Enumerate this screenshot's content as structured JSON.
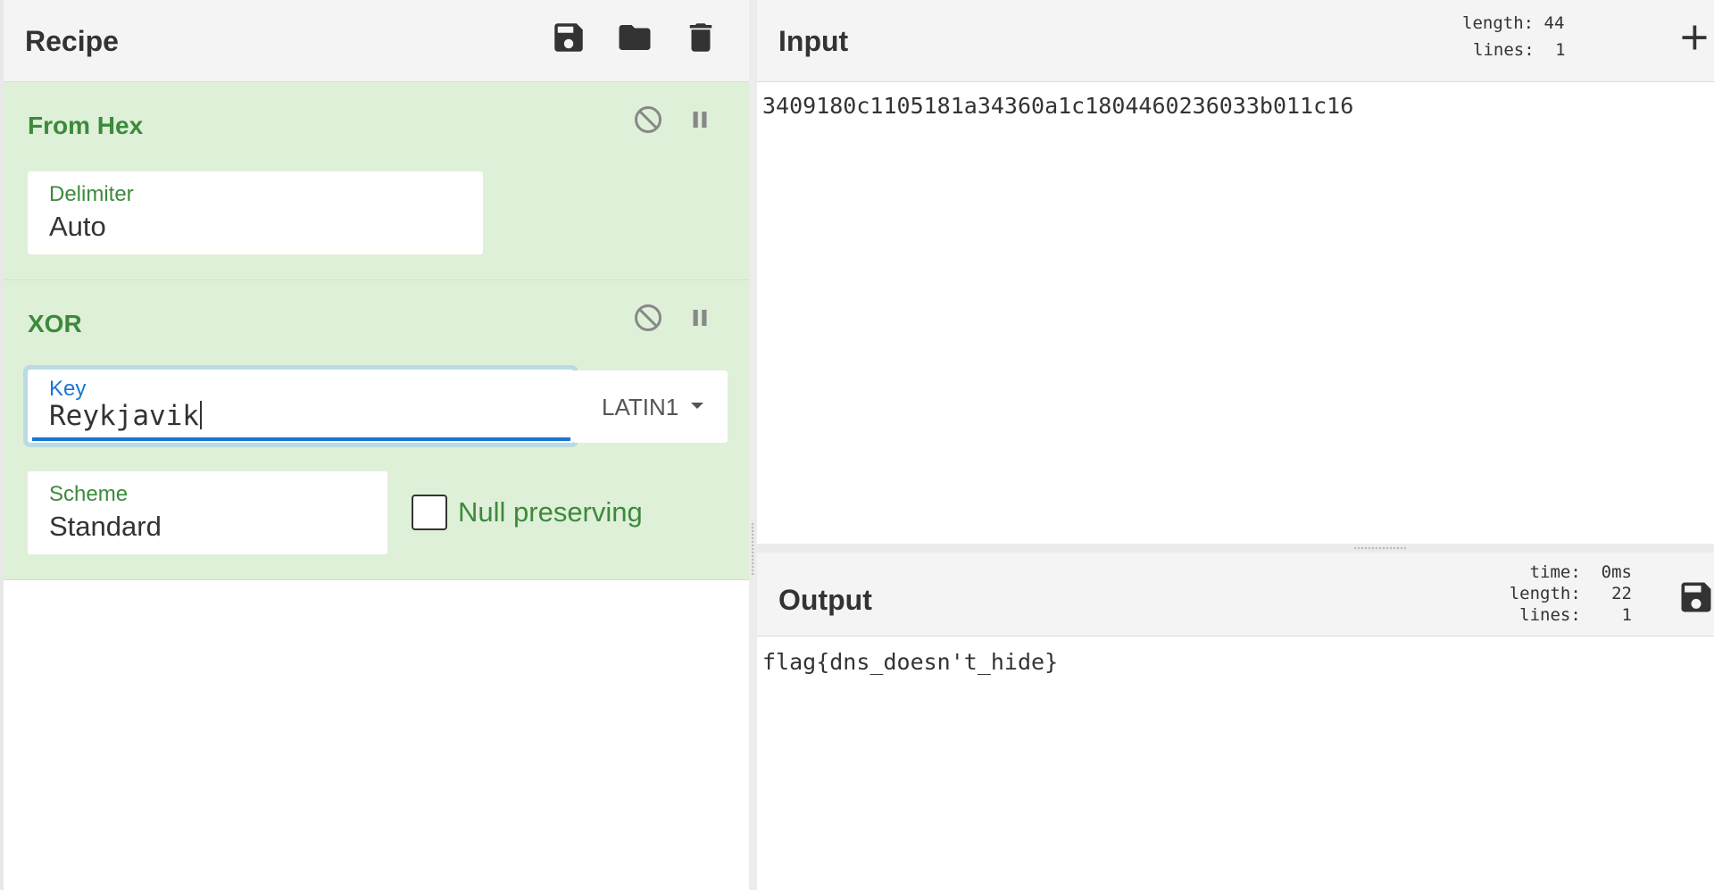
{
  "recipe": {
    "title": "Recipe",
    "icons": [
      "save-icon",
      "folder-icon",
      "trash-icon"
    ],
    "operations": [
      {
        "name": "From Hex",
        "fields": [
          {
            "label": "Delimiter",
            "value": "Auto"
          }
        ]
      },
      {
        "name": "XOR",
        "key": {
          "label": "Key",
          "value": "Reykjavik",
          "encoding": "LATIN1"
        },
        "scheme": {
          "label": "Scheme",
          "value": "Standard"
        },
        "null_preserving": {
          "label": "Null preserving",
          "checked": false
        }
      }
    ]
  },
  "input": {
    "title": "Input",
    "stats": {
      "length_label": "length:",
      "length": "44",
      "lines_label": "lines:",
      "lines": "1"
    },
    "text": "3409180c1105181a34360a1c1804460236033b011c16"
  },
  "output": {
    "title": "Output",
    "stats": {
      "time_label": "time:",
      "time": "0ms",
      "length_label": "length:",
      "length": "22",
      "lines_label": "lines:",
      "lines": "1"
    },
    "text": "flag{dns_doesn't_hide}"
  },
  "colors": {
    "op_bg": "#dff0d8",
    "op_title": "#3c8a3c",
    "focus": "#1976d2"
  }
}
